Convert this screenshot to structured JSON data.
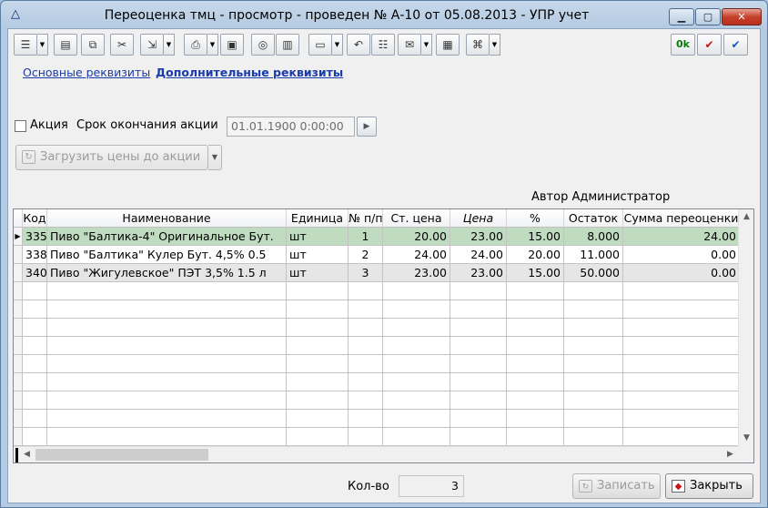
{
  "window": {
    "title": "Переоценка тмц - просмотр - проведен № А-10 от 05.08.2013 - УПР учет",
    "app_icon": "triangle-logo-icon"
  },
  "toolbar": {
    "icons": [
      "document-list-icon",
      "list-icon",
      "copy-icon",
      "cut-icon",
      "import-icon",
      "print-icon",
      "picture-icon",
      "brain-icon",
      "book-icon",
      "stamp-icon",
      "undo-icon",
      "structure-icon",
      "envelope-icon",
      "barcode-icon",
      "network-icon",
      "ok-icon",
      "check-red-icon",
      "check-blue-icon"
    ],
    "ok_label": "0k"
  },
  "tabs": {
    "basic": "Основные реквизиты",
    "extra": "Дополнительные реквизиты"
  },
  "promo": {
    "checkbox_label": "Акция",
    "end_label": "Срок окончания акции",
    "end_value": "01.01.1900 0:00:00",
    "checked": false
  },
  "load_button": {
    "label": "Загрузить цены до акции"
  },
  "author": "Автор Администратор",
  "table": {
    "headers": [
      "Код",
      "Наименование",
      "Единица",
      "№ п/п",
      "Ст. цена",
      "Цена",
      "%",
      "Остаток",
      "Сумма переоценки"
    ],
    "rows": [
      [
        "335",
        "Пиво \"Балтика-4\" Оригинальное Бут.",
        "шт",
        "1",
        "20.00",
        "23.00",
        "15.00",
        "8.000",
        "24.00"
      ],
      [
        "338",
        "Пиво \"Балтика\" Кулер Бут. 4,5% 0.5",
        "шт",
        "2",
        "24.00",
        "24.00",
        "20.00",
        "11.000",
        "0.00"
      ],
      [
        "340",
        "Пиво \"Жигулевское\"  ПЭТ 3,5% 1.5 л",
        "шт",
        "3",
        "23.00",
        "23.00",
        "15.00",
        "50.000",
        "0.00"
      ]
    ],
    "selected_row": 0
  },
  "footer": {
    "count_label": "Кол-во",
    "count_value": "3",
    "save_label": "Записать",
    "close_label": "Закрыть"
  }
}
